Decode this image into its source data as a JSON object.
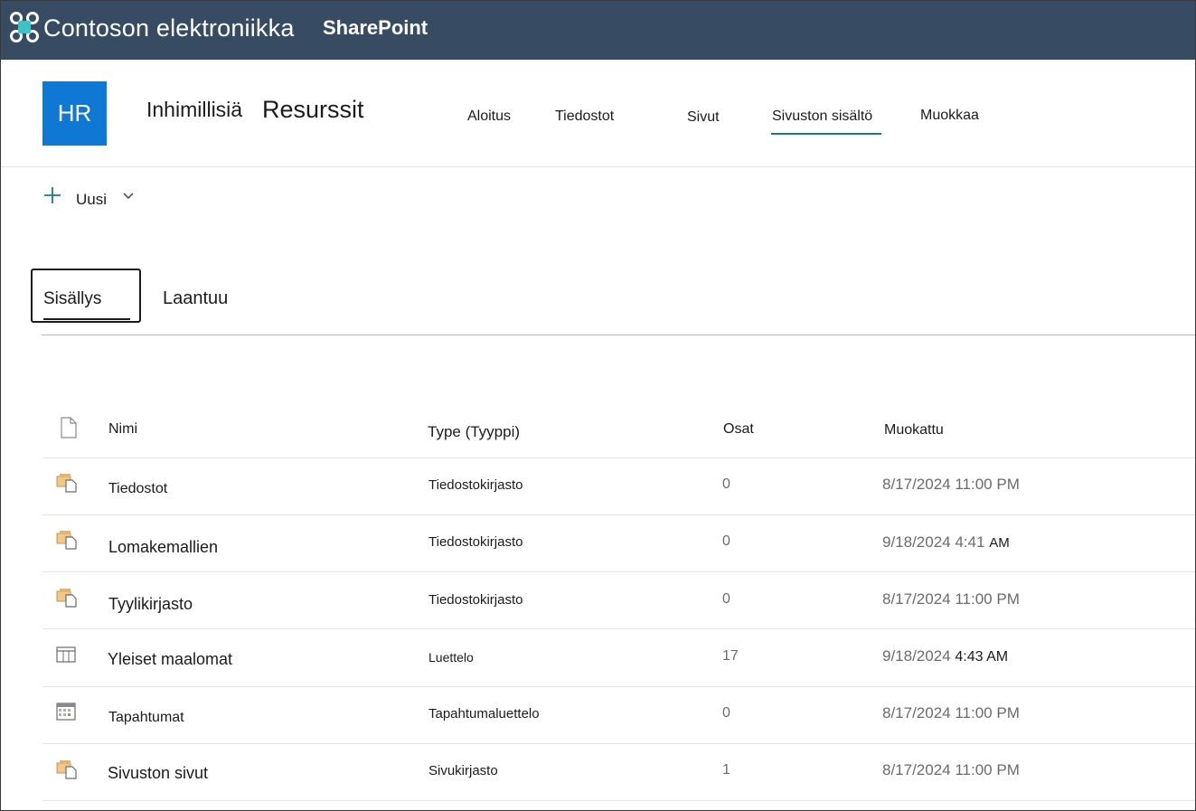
{
  "suite_bar": {
    "org_name": "Contoson elektroniikka",
    "app_name": "SharePoint",
    "background": "#374c63"
  },
  "site": {
    "logo_text": "HR",
    "logo_color": "#0f78d4",
    "title_part1": "Inhimillisiä",
    "title_part2": "Resurssit",
    "nav": [
      {
        "label": "Aloitus"
      },
      {
        "label": "Tiedostot"
      },
      {
        "label": "Sivut"
      },
      {
        "label": "Sivuston sisältö",
        "selected": true
      },
      {
        "label": "Muokkaa"
      }
    ],
    "accent": "#107c8c"
  },
  "command_bar": {
    "new_label": "Uusi"
  },
  "tabs": [
    {
      "label": "Sisällys",
      "selected": true
    },
    {
      "label": "Laantuu"
    }
  ],
  "table": {
    "headers": {
      "name": "Nimi",
      "type": "Type (Tyyppi)",
      "items": "Osat",
      "modified": "Muokattu"
    },
    "rows": [
      {
        "icon": "library-icon",
        "name": "Tiedostot",
        "type": "Tiedostokirjasto",
        "items": "0",
        "modified": "8/17/2024 11:00 PM",
        "modified_suffix": ""
      },
      {
        "icon": "library-icon",
        "name": "Lomakemallien",
        "type": "Tiedostokirjasto",
        "items": "0",
        "modified": "9/18/2024 4:41",
        "modified_suffix": "AM"
      },
      {
        "icon": "library-icon",
        "name": "Tyylikirjasto",
        "type": "Tiedostokirjasto",
        "items": "0",
        "modified": "8/17/2024 11:00 PM",
        "modified_suffix": ""
      },
      {
        "icon": "list-icon",
        "name": "Yleiset maalomat",
        "type": "Luettelo",
        "items": "17",
        "modified": "9/18/2024",
        "modified_suffix": "4:43 AM"
      },
      {
        "icon": "calendar-icon",
        "name": "Tapahtumat",
        "type": "Tapahtumaluettelo",
        "items": "0",
        "modified": "8/17/2024 11:00 PM",
        "modified_suffix": ""
      },
      {
        "icon": "library-icon",
        "name": "Sivuston sivut",
        "type": "Sivukirjasto",
        "items": "1",
        "modified": "8/17/2024 11:00 PM",
        "modified_suffix": ""
      }
    ]
  }
}
